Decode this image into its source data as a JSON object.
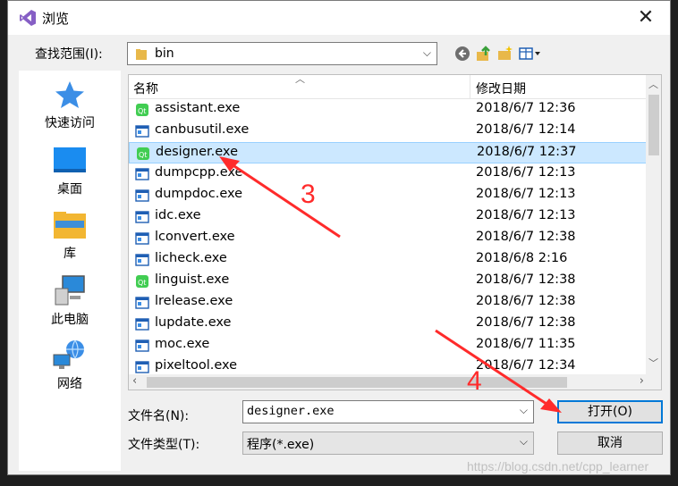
{
  "window": {
    "title": "浏览"
  },
  "lookin": {
    "label": "查找范围(I):",
    "folder": "bin"
  },
  "places": [
    {
      "label": "快速访问",
      "icon": "star-icon"
    },
    {
      "label": "桌面",
      "icon": "desktop-icon"
    },
    {
      "label": "库",
      "icon": "library-icon"
    },
    {
      "label": "此电脑",
      "icon": "computer-icon"
    },
    {
      "label": "网络",
      "icon": "network-icon"
    }
  ],
  "list": {
    "col_name": "名称",
    "col_date": "修改日期",
    "rows": [
      {
        "name": "assistant.exe",
        "date": "2018/6/7 12:36",
        "icon": "qt-icon"
      },
      {
        "name": "canbusutil.exe",
        "date": "2018/6/7 12:14",
        "icon": "exe-icon"
      },
      {
        "name": "designer.exe",
        "date": "2018/6/7 12:37",
        "icon": "qt-icon",
        "selected": true
      },
      {
        "name": "dumpcpp.exe",
        "date": "2018/6/7 12:13",
        "icon": "exe-icon"
      },
      {
        "name": "dumpdoc.exe",
        "date": "2018/6/7 12:13",
        "icon": "exe-icon"
      },
      {
        "name": "idc.exe",
        "date": "2018/6/7 12:13",
        "icon": "exe-icon"
      },
      {
        "name": "lconvert.exe",
        "date": "2018/6/7 12:38",
        "icon": "exe-icon"
      },
      {
        "name": "licheck.exe",
        "date": "2018/6/8 2:16",
        "icon": "exe-icon"
      },
      {
        "name": "linguist.exe",
        "date": "2018/6/7 12:38",
        "icon": "qt-icon"
      },
      {
        "name": "lrelease.exe",
        "date": "2018/6/7 12:38",
        "icon": "exe-icon"
      },
      {
        "name": "lupdate.exe",
        "date": "2018/6/7 12:38",
        "icon": "exe-icon"
      },
      {
        "name": "moc.exe",
        "date": "2018/6/7 11:35",
        "icon": "exe-icon"
      },
      {
        "name": "pixeltool.exe",
        "date": "2018/6/7 12:34",
        "icon": "exe-icon"
      }
    ]
  },
  "filename": {
    "label": "文件名(N):",
    "value": "designer.exe"
  },
  "filetype": {
    "label": "文件类型(T):",
    "value": "程序(*.exe)"
  },
  "buttons": {
    "open": "打开(O)",
    "cancel": "取消"
  },
  "annotations": {
    "step3": "3",
    "step4": "4",
    "color": "#ff2b2b"
  },
  "watermark": "https://blog.csdn.net/cpp_learner"
}
